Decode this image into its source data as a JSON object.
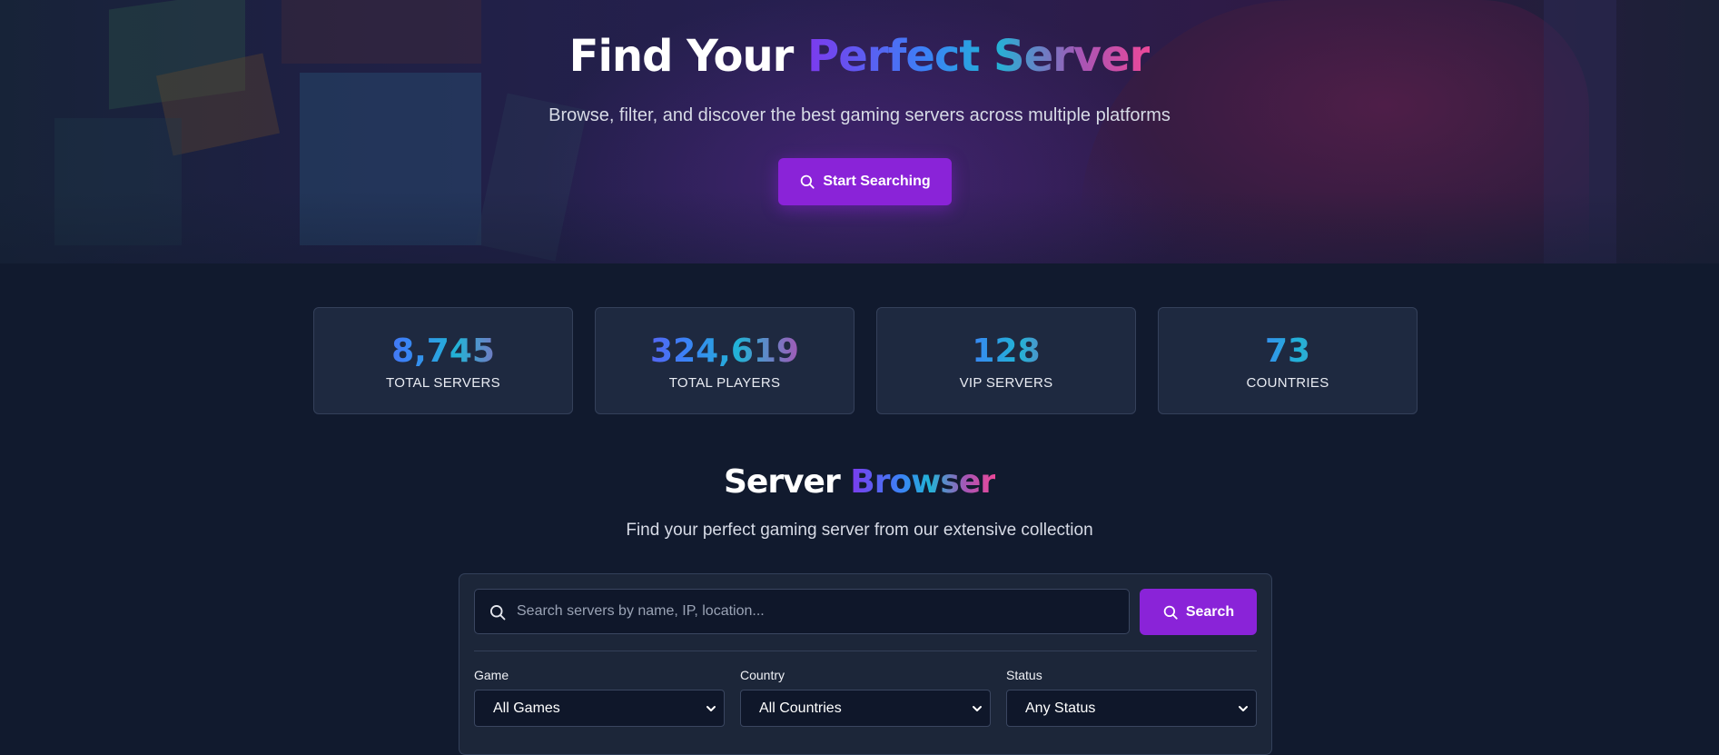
{
  "hero": {
    "title_plain": "Find Your ",
    "title_accent": "Perfect Server",
    "subtitle": "Browse, filter, and discover the best gaming servers across multiple platforms",
    "cta_label": "Start Searching"
  },
  "stats": [
    {
      "value": "8,745",
      "label": "TOTAL SERVERS"
    },
    {
      "value": "324,619",
      "label": "TOTAL PLAYERS"
    },
    {
      "value": "128",
      "label": "VIP SERVERS"
    },
    {
      "value": "73",
      "label": "COUNTRIES"
    }
  ],
  "browser": {
    "title_plain": "Server ",
    "title_accent": "Browser",
    "subtitle": "Find your perfect gaming server from our extensive collection",
    "search_placeholder": "Search servers by name, IP, location...",
    "search_button": "Search",
    "filters": [
      {
        "label": "Game",
        "value": "All Games"
      },
      {
        "label": "Country",
        "value": "All Countries"
      },
      {
        "label": "Status",
        "value": "Any Status"
      }
    ]
  },
  "colors": {
    "accent": "#8a23d8",
    "background": "#111a2e",
    "card": "#1e2940"
  },
  "icons": [
    "search-icon",
    "chevron-down-icon"
  ]
}
